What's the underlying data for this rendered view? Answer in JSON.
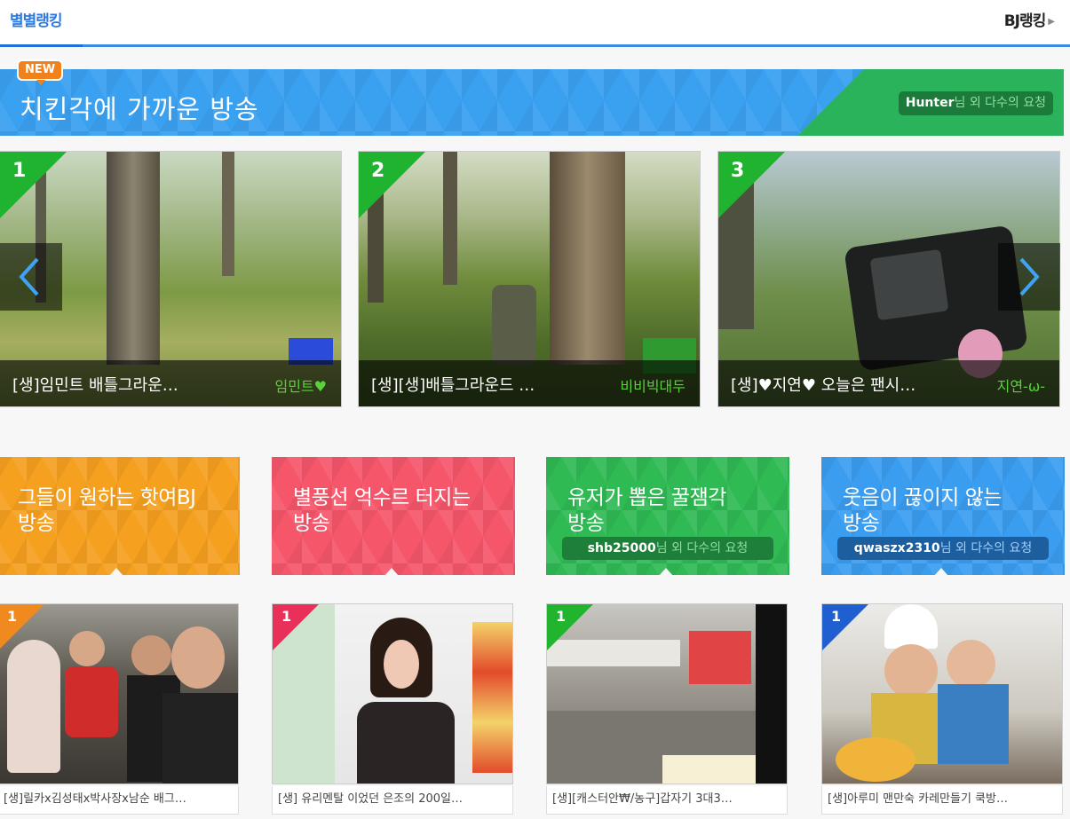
{
  "tabs": {
    "active": "별별랭킹",
    "bj_link": "BJ랭킹"
  },
  "banner": {
    "badge": "NEW",
    "title": "치킨각에 가까운 방송",
    "request_user": "Hunter",
    "request_suffix": "님 외 다수의 요청"
  },
  "top_streams": [
    {
      "rank": "1",
      "title": "[생]임민트 배틀그라운…",
      "bj": "임민트♥"
    },
    {
      "rank": "2",
      "title": "[생][생]배틀그라운드 …",
      "bj": "비비빅대두"
    },
    {
      "rank": "3",
      "title": "[생]♥지연♥ 오늘은 팬시…",
      "bj": "지연-ω-"
    }
  ],
  "categories": [
    {
      "line1": "그들이 원하는 핫여BJ",
      "line2": "방송",
      "request_user": "",
      "request_suffix": "",
      "color": "#f5a01f"
    },
    {
      "line1": "별풍선 억수르 터지는",
      "line2": "방송",
      "request_user": "",
      "request_suffix": "",
      "color": "#f5566a"
    },
    {
      "line1": "유저가 뽑은 꿀잼각",
      "line2": "방송",
      "request_user": "shb25000",
      "request_suffix": "님 외 다수의 요청",
      "color": "#2fba54"
    },
    {
      "line1": "웃음이 끊이지 않는",
      "line2": "방송",
      "request_user": "qwaszx2310",
      "request_suffix": "님 외 다수의 요청",
      "color": "#3a9df0"
    }
  ],
  "bottom_streams": [
    {
      "rank": "1",
      "title": "[생]릴카x김성태x박사장x남순 배그…",
      "color": "#f08a1e"
    },
    {
      "rank": "1",
      "title": "[생] 유리멘탈 이었던 은조의 200일…",
      "color": "#e8305a"
    },
    {
      "rank": "1",
      "title": "[생][캐스터안₩/농구]갑자기 3대3…",
      "color": "#21b42f"
    },
    {
      "rank": "1",
      "title": "[생]아루미 맨만숙 카레만들기 쿡방…",
      "color": "#1f5fd0"
    }
  ],
  "icons": {
    "prev": "chevron-left-icon",
    "next": "chevron-right-icon",
    "bj_arrow": "caret-right-icon"
  }
}
